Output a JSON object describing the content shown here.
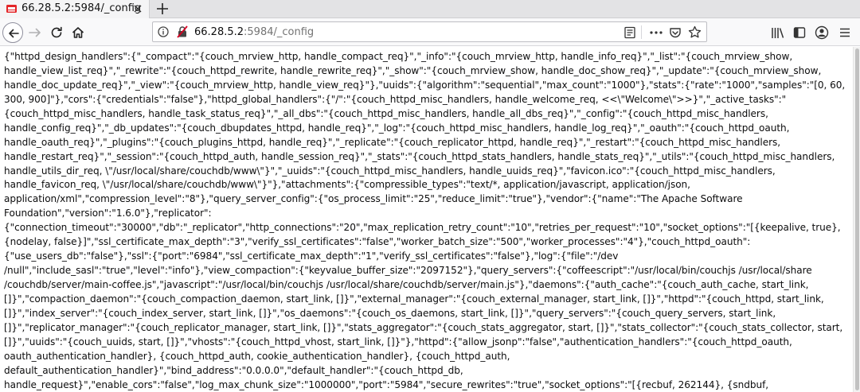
{
  "tab": {
    "title": "66.28.5.2:5984/_config"
  },
  "urlbar": {
    "host": "66.28.5.2",
    "path": ":5984/_config"
  },
  "icons": {
    "favicon": "couchdb-icon",
    "tab_close": "close-icon",
    "new_tab": "plus-icon",
    "back": "arrow-left-icon",
    "forward": "arrow-right-icon",
    "reload": "reload-icon",
    "home": "home-icon",
    "site_info": "info-icon",
    "insecure": "insecure-lock-icon",
    "reader": "reader-view-icon",
    "more": "ellipsis-icon",
    "pocket": "pocket-icon",
    "bookmark": "star-icon",
    "library": "library-icon",
    "sidebar": "sidebar-icon",
    "account": "account-icon",
    "menu": "hamburger-menu-icon"
  },
  "colors": {
    "accent_red": "#d70022",
    "text": "#0c0c0d",
    "muted": "#737373"
  },
  "content": {
    "lines": [
      "{\"httpd_design_handlers\":{\"_compact\":\"{couch_mrview_http, handle_compact_req}\",\"_info\":\"{couch_mrview_http, handle_info_req}\",\"_list\":\"{couch_mrview_show,",
      "handle_view_list_req}\",\"_rewrite\":\"{couch_httpd_rewrite, handle_rewrite_req}\",\"_show\":\"{couch_mrview_show, handle_doc_show_req}\",\"_update\":\"{couch_mrview_show,",
      "handle_doc_update_req}\",\"_view\":\"{couch_mrview_http, handle_view_req}\"},\"uuids\":{\"algorithm\":\"sequential\",\"max_count\":\"1000\"},\"stats\":{\"rate\":\"1000\",\"samples\":\"[0, 60,",
      "300, 900]\"},\"cors\":{\"credentials\":\"false\"},\"httpd_global_handlers\":{\"/\":\"{couch_httpd_misc_handlers, handle_welcome_req, <<\\\"Welcome\\\">>}\",\"_active_tasks\":\"",
      "{couch_httpd_misc_handlers, handle_task_status_req}\",\"_all_dbs\":\"{couch_httpd_misc_handlers, handle_all_dbs_req}\",\"_config\":\"{couch_httpd_misc_handlers,",
      "handle_config_req}\",\"_db_updates\":\"{couch_dbupdates_httpd, handle_req}\",\"_log\":\"{couch_httpd_misc_handlers, handle_log_req}\",\"_oauth\":\"{couch_httpd_oauth,",
      "handle_oauth_req}\",\"_plugins\":\"{couch_plugins_httpd, handle_req}\",\"_replicate\":\"{couch_replicator_httpd, handle_req}\",\"_restart\":\"{couch_httpd_misc_handlers,",
      "handle_restart_req}\",\"_session\":\"{couch_httpd_auth, handle_session_req}\",\"_stats\":\"{couch_httpd_stats_handlers, handle_stats_req}\",\"_utils\":\"{couch_httpd_misc_handlers,",
      "handle_utils_dir_req, \\\"/usr/local/share/couchdb/www\\\"}\",\"_uuids\":\"{couch_httpd_misc_handlers, handle_uuids_req}\",\"favicon.ico\":\"{couch_httpd_misc_handlers,",
      "handle_favicon_req, \\\"/usr/local/share/couchdb/www\\\"}\"},\"attachments\":{\"compressible_types\":\"text/*, application/javascript, application/json,",
      "application/xml\",\"compression_level\":\"8\"},\"query_server_config\":{\"os_process_limit\":\"25\",\"reduce_limit\":\"true\"},\"vendor\":{\"name\":\"The Apache Software",
      "Foundation\",\"version\":\"1.6.0\"},\"replicator\":",
      "{\"connection_timeout\":\"30000\",\"db\":\"_replicator\",\"http_connections\":\"20\",\"max_replication_retry_count\":\"10\",\"retries_per_request\":\"10\",\"socket_options\":\"[{keepalive, true},",
      "{nodelay, false}]\",\"ssl_certificate_max_depth\":\"3\",\"verify_ssl_certificates\":\"false\",\"worker_batch_size\":\"500\",\"worker_processes\":\"4\"},\"couch_httpd_oauth\":",
      "{\"use_users_db\":\"false\"},\"ssl\":{\"port\":\"6984\",\"ssl_certificate_max_depth\":\"1\",\"verify_ssl_certificates\":\"false\"},\"log\":{\"file\":\"/dev",
      "/null\",\"include_sasl\":\"true\",\"level\":\"info\"},\"view_compaction\":{\"keyvalue_buffer_size\":\"2097152\"},\"query_servers\":{\"coffeescript\":\"/usr/local/bin/couchjs /usr/local/share",
      "/couchdb/server/main-coffee.js\",\"javascript\":\"/usr/local/bin/couchjs /usr/local/share/couchdb/server/main.js\"},\"daemons\":{\"auth_cache\":\"{couch_auth_cache, start_link,",
      "[]}\",\"compaction_daemon\":\"{couch_compaction_daemon, start_link, []}\",\"external_manager\":\"{couch_external_manager, start_link, []}\",\"httpd\":\"{couch_httpd, start_link,",
      "[]}\",\"index_server\":\"{couch_index_server, start_link, []}\",\"os_daemons\":\"{couch_os_daemons, start_link, []}\",\"query_servers\":\"{couch_query_servers, start_link,",
      "[]}\",\"replicator_manager\":\"{couch_replicator_manager, start_link, []}\",\"stats_aggregator\":\"{couch_stats_aggregator, start, []}\",\"stats_collector\":\"{couch_stats_collector, start,",
      "[]}\",\"uuids\":\"{couch_uuids, start, []}\",\"vhosts\":\"{couch_httpd_vhost, start_link, []}\"},\"httpd\":{\"allow_jsonp\":\"false\",\"authentication_handlers\":\"{couch_httpd_oauth,",
      "oauth_authentication_handler}, {couch_httpd_auth, cookie_authentication_handler}, {couch_httpd_auth,",
      "default_authentication_handler}\",\"bind_address\":\"0.0.0.0\",\"default_handler\":\"{couch_httpd_db,",
      "handle_request}\",\"enable_cors\":\"false\",\"log_max_chunk_size\":\"1000000\",\"port\":\"5984\",\"secure_rewrites\":\"true\",\"socket_options\":\"[{recbuf, 262144}, {sndbuf,"
    ]
  }
}
